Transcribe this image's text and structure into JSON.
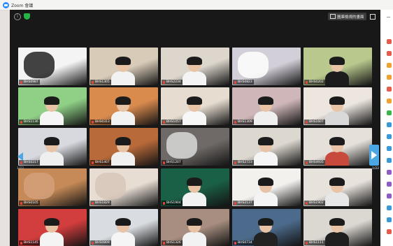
{
  "window": {
    "title": "Zoom 會議"
  },
  "toolbar": {
    "view_label": "圖庫檢視的畫面"
  },
  "pagination": {
    "left": "1/22",
    "right": "1/22"
  },
  "participants": [
    {
      "name": "BHS0987",
      "bg": "#f4f4f4",
      "accent": "#222",
      "person": false
    },
    {
      "name": "BHS1305",
      "bg": "#d8cbb8",
      "accent": "#f2f2f2",
      "person": true
    },
    {
      "name": "BHS2234",
      "bg": "#dcd6cc",
      "accent": "#f4f4f4",
      "person": true
    },
    {
      "name": "BHS0823",
      "bg": "#d2cfd8",
      "accent": "#ffffff",
      "person": false
    },
    {
      "name": "BHS0202",
      "bg": "#b9c98e",
      "accent": "#1c1c1c",
      "person": true
    },
    {
      "name": "BHS1136",
      "bg": "#8fcf86",
      "accent": "#f5f5f5",
      "person": true
    },
    {
      "name": "BHS0313",
      "bg": "#d98b4e",
      "accent": "#f2f2f2",
      "person": true
    },
    {
      "name": "BHS1057",
      "bg": "#e6ddd0",
      "accent": "#f7f7f7",
      "person": true
    },
    {
      "name": "BHS1309",
      "bg": "#cfb7b9",
      "accent": "#efefef",
      "person": true
    },
    {
      "name": "BHS1607",
      "bg": "#ece6df",
      "accent": "#d9d9d9",
      "person": true
    },
    {
      "name": "BHS0217",
      "bg": "#d7d9df",
      "accent": "#efefef",
      "person": true
    },
    {
      "name": "BHS1407",
      "bg": "#b86a3a",
      "accent": "#f0f0f0",
      "person": true
    },
    {
      "name": "BHS1207",
      "bg": "#6f6a67",
      "accent": "#d9d9d9",
      "person": false
    },
    {
      "name": "BHS2723",
      "bg": "#dcd7cf",
      "accent": "#f5f5f5",
      "person": true
    },
    {
      "name": "BHS4935",
      "bg": "#e5e0da",
      "accent": "#c84a3c",
      "person": true
    },
    {
      "name": "BHS0105",
      "bg": "#c58a57",
      "accent": "#d3a07a",
      "person": false
    },
    {
      "name": "BHS1829",
      "bg": "#e7ddd3",
      "accent": "#d7c6b9",
      "person": false
    },
    {
      "name": "BHS1904",
      "bg": "#1a6046",
      "accent": "#f2f2f2",
      "person": true
    },
    {
      "name": "BHS2137",
      "bg": "#f3f1ee",
      "accent": "#f4f4f4",
      "person": true
    },
    {
      "name": "BHS1902",
      "bg": "#e8e2dc",
      "accent": "#e7e7e7",
      "person": true
    },
    {
      "name": "BHS1145",
      "bg": "#d23d3d",
      "accent": "#f4f4f4",
      "person": true
    },
    {
      "name": "BHS0809",
      "bg": "#d9dce0",
      "accent": "#f5f5f5",
      "person": true
    },
    {
      "name": "BHS1326",
      "bg": "#a78e80",
      "accent": "#f2f2f2",
      "person": true
    },
    {
      "name": "BHS0734",
      "bg": "#4c6a8b",
      "accent": "#222",
      "person": true
    },
    {
      "name": "BHS1111",
      "bg": "#dbd7d1",
      "accent": "#1f1f1f",
      "person": true
    }
  ],
  "side_icons": [
    "#e85b4a",
    "#e85b4a",
    "#f0a12f",
    "#f0a12f",
    "#e85b4a",
    "#f0a12f",
    "#3bb54a",
    "#3a9ad9",
    "#3a9ad9",
    "#3a9ad9",
    "#3a9ad9",
    "#8e5bc7",
    "#8e5bc7",
    "#8e5bc7",
    "#3a9ad9",
    "#3a9ad9",
    "#e85b4a"
  ]
}
